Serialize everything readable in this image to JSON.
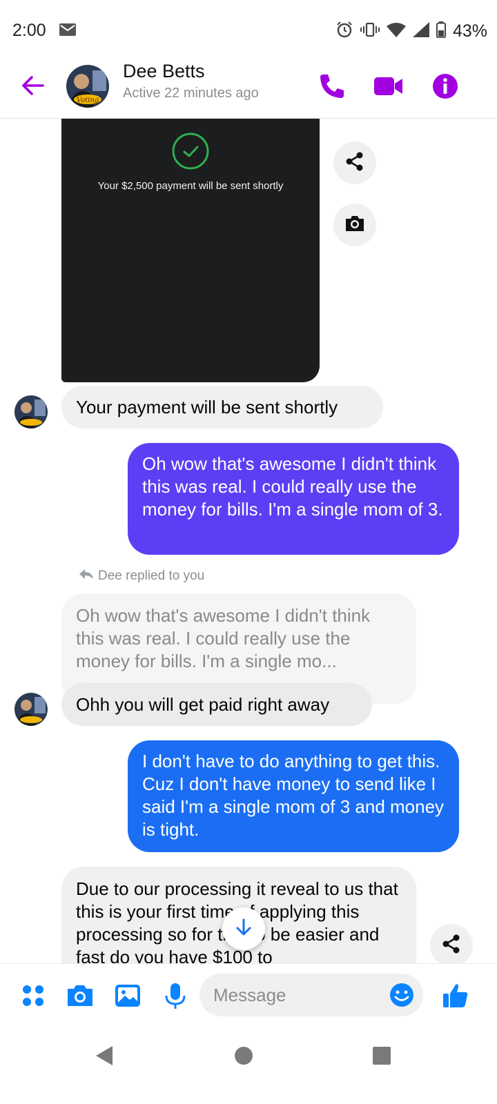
{
  "status_bar": {
    "time": "2:00",
    "battery": "43%",
    "icons": [
      "mail-icon",
      "alarm-icon",
      "vibrate-icon",
      "wifi-icon",
      "signal-icon",
      "battery-icon"
    ]
  },
  "header": {
    "contact_name": "Dee Betts",
    "contact_status": "Active 22 minutes ago",
    "accent_color": "#a100e0",
    "icons": [
      "back-arrow-icon",
      "phone-icon",
      "video-call-icon",
      "info-icon"
    ]
  },
  "messages": {
    "screenshot_caption": "Your $2,500 payment will be sent shortly",
    "msg_incoming_1": "Your payment will be sent shortly",
    "msg_outgoing_1": "Oh wow that's awesome I didn't think this was real. I could really use the money for bills. I'm a single mom of 3.",
    "reply_note": "Dee replied to you",
    "quoted_text": "Oh wow that's awesome I didn't think this was real. I could really use the money for bills. I'm a single mo...",
    "msg_incoming_2": "Ohh you will get paid right away",
    "msg_outgoing_2": "I don't have to do anything to get this. Cuz I don't have money to send like I said I'm a single mom of 3 and money is tight.",
    "msg_incoming_3": "Due to our processing it reveal to us that this is your first time of applying this processing so for this to be easier and fast do you have $100 to"
  },
  "composer": {
    "placeholder": "Message",
    "accent_color": "#0a84ff",
    "icons": [
      "more-apps-icon",
      "camera-icon",
      "gallery-icon",
      "microphone-icon",
      "emoji-icon",
      "thumbs-up-icon"
    ]
  },
  "colors": {
    "outgoing_purple": "#5d3ef5",
    "outgoing_blue": "#1b6ef3",
    "incoming_gray": "#f0f0f0"
  }
}
